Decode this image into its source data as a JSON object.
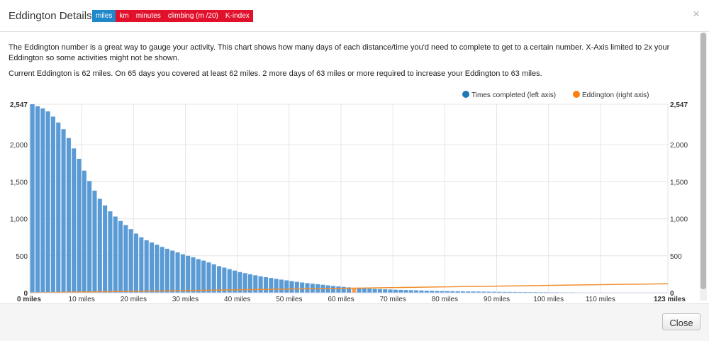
{
  "header": {
    "title": "Eddington Details",
    "tabs": [
      "miles",
      "km",
      "minutes",
      "climbing (m /20)",
      "K-index"
    ],
    "active_tab": 0,
    "close_glyph": "×"
  },
  "description": {
    "paragraph1": "The Eddington number is a great way to gauge your activity. This chart shows how many days of each distance/time you'd need to complete to get to a certain number. X-Axis limited to 2x your Eddington so some activities might not be shown.",
    "paragraph2": "Current Eddington is 62 miles. On 65 days you covered at least 62 miles. 2 more days of 63 miles or more required to increase your Eddington to 63 miles."
  },
  "footer": {
    "close_label": "Close"
  },
  "colors": {
    "bar": "#5b9bd5",
    "bar_highlight": "#f6a04d",
    "eddington_line": "#f28e2b",
    "legend_blue": "#1f77b4",
    "legend_orange": "#ff7f0e",
    "tab_red": "#e1102b",
    "tab_blue": "#1e88c8"
  },
  "chart_data": {
    "type": "bar",
    "title": "",
    "x_unit": "miles",
    "xlim": [
      0,
      123
    ],
    "ylim": [
      0,
      2547
    ],
    "x_tick_labels": [
      "0 miles",
      "10 miles",
      "20 miles",
      "30 miles",
      "40 miles",
      "50 miles",
      "60 miles",
      "70 miles",
      "80 miles",
      "90 miles",
      "100 miles",
      "110 miles",
      "123 miles"
    ],
    "y_tick_labels_left": [
      "2,547",
      "2,000",
      "1,500",
      "1,000",
      "500",
      "0"
    ],
    "y_tick_labels_right": [
      "2,547",
      "2,000",
      "1,500",
      "1,000",
      "500",
      "0"
    ],
    "y_ticks": [
      2547,
      2000,
      1500,
      1000,
      500,
      0
    ],
    "grid": true,
    "legend_position": "top-right",
    "highlight_x": 62,
    "series": [
      {
        "name": "Times completed (left axis)",
        "axis": "left",
        "values": [
          2547,
          2520,
          2490,
          2450,
          2380,
          2300,
          2210,
          2090,
          1950,
          1810,
          1650,
          1510,
          1380,
          1270,
          1180,
          1100,
          1030,
          970,
          915,
          860,
          800,
          750,
          710,
          680,
          650,
          620,
          595,
          570,
          545,
          520,
          500,
          480,
          455,
          435,
          410,
          385,
          360,
          340,
          320,
          300,
          280,
          265,
          250,
          236,
          223,
          211,
          200,
          189,
          178,
          168,
          158,
          148,
          139,
          131,
          123,
          116,
          108,
          100,
          93,
          86,
          80,
          73,
          67,
          63,
          59,
          56,
          53,
          50,
          47,
          44,
          41,
          39,
          37,
          35,
          33,
          31,
          29,
          27,
          25,
          24,
          23,
          22,
          21,
          20,
          19,
          18,
          17,
          16,
          15,
          14,
          13,
          12,
          12,
          11,
          10,
          10,
          9,
          9,
          8,
          8,
          7,
          7,
          6,
          6,
          6,
          5,
          5,
          5,
          4,
          4,
          4,
          4,
          3,
          3,
          3,
          3,
          3,
          2,
          2,
          2,
          2,
          2,
          2
        ]
      },
      {
        "name": "Eddington (right axis)",
        "axis": "right",
        "type": "line",
        "x": [
          0,
          62,
          123
        ],
        "values": [
          0,
          62,
          123
        ]
      }
    ]
  }
}
